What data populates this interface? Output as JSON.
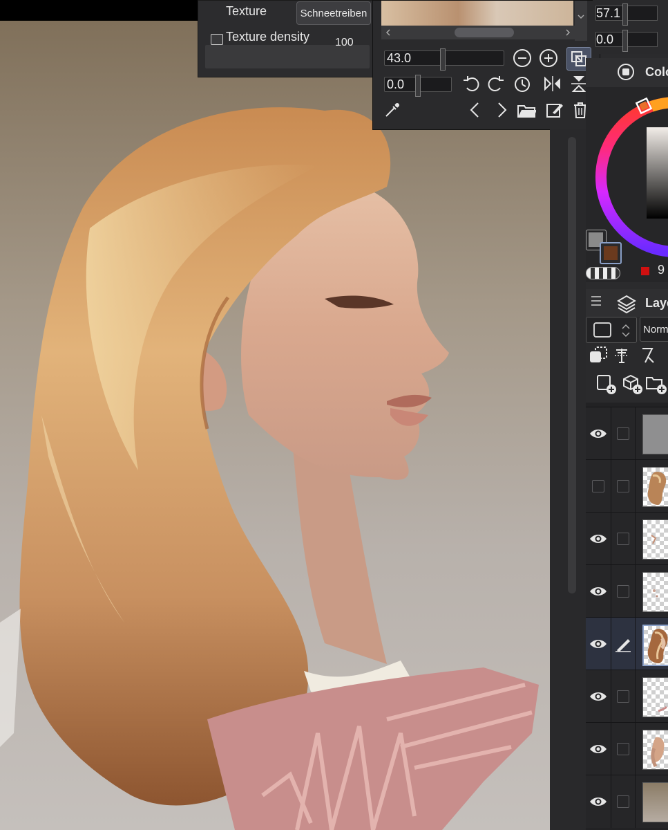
{
  "texture_panel": {
    "texture_label": "Texture",
    "texture_value": "Schneetreiben",
    "density_label": "Texture density",
    "density_value": "100"
  },
  "navigator": {
    "zoom_value": "43.0",
    "rotation_value": "0.0",
    "icons": [
      "zoom-out-icon",
      "zoom-in-icon",
      "fit-view-icon",
      "rotate-left-icon",
      "rotate-right-icon",
      "reset-rotation-icon",
      "flip-horizontal-icon",
      "flip-vertical-icon",
      "eyedropper-icon",
      "prev-icon",
      "next-icon",
      "open-folder-icon",
      "edit-icon",
      "trash-icon"
    ]
  },
  "dock_top": {
    "value1": "57.1",
    "value2": "0.0"
  },
  "color_panel": {
    "title": "Colo",
    "value": "9",
    "foreground_color": "#6b3a1e",
    "background_color": "#8a8a8a",
    "selected_hue": "#e8702a"
  },
  "layer_panel": {
    "title": "Laye",
    "blend_mode": "Norm",
    "layers": [
      {
        "visible": true,
        "editing": false,
        "thumb": "gray"
      },
      {
        "visible": false,
        "editing": false,
        "thumb": "hair"
      },
      {
        "visible": true,
        "editing": false,
        "thumb": "sparse"
      },
      {
        "visible": true,
        "editing": false,
        "thumb": "sparse2"
      },
      {
        "visible": true,
        "editing": true,
        "thumb": "hair-active"
      },
      {
        "visible": true,
        "editing": false,
        "thumb": "sparse3"
      },
      {
        "visible": true,
        "editing": false,
        "thumb": "face"
      },
      {
        "visible": true,
        "editing": false,
        "thumb": "bg"
      }
    ]
  }
}
